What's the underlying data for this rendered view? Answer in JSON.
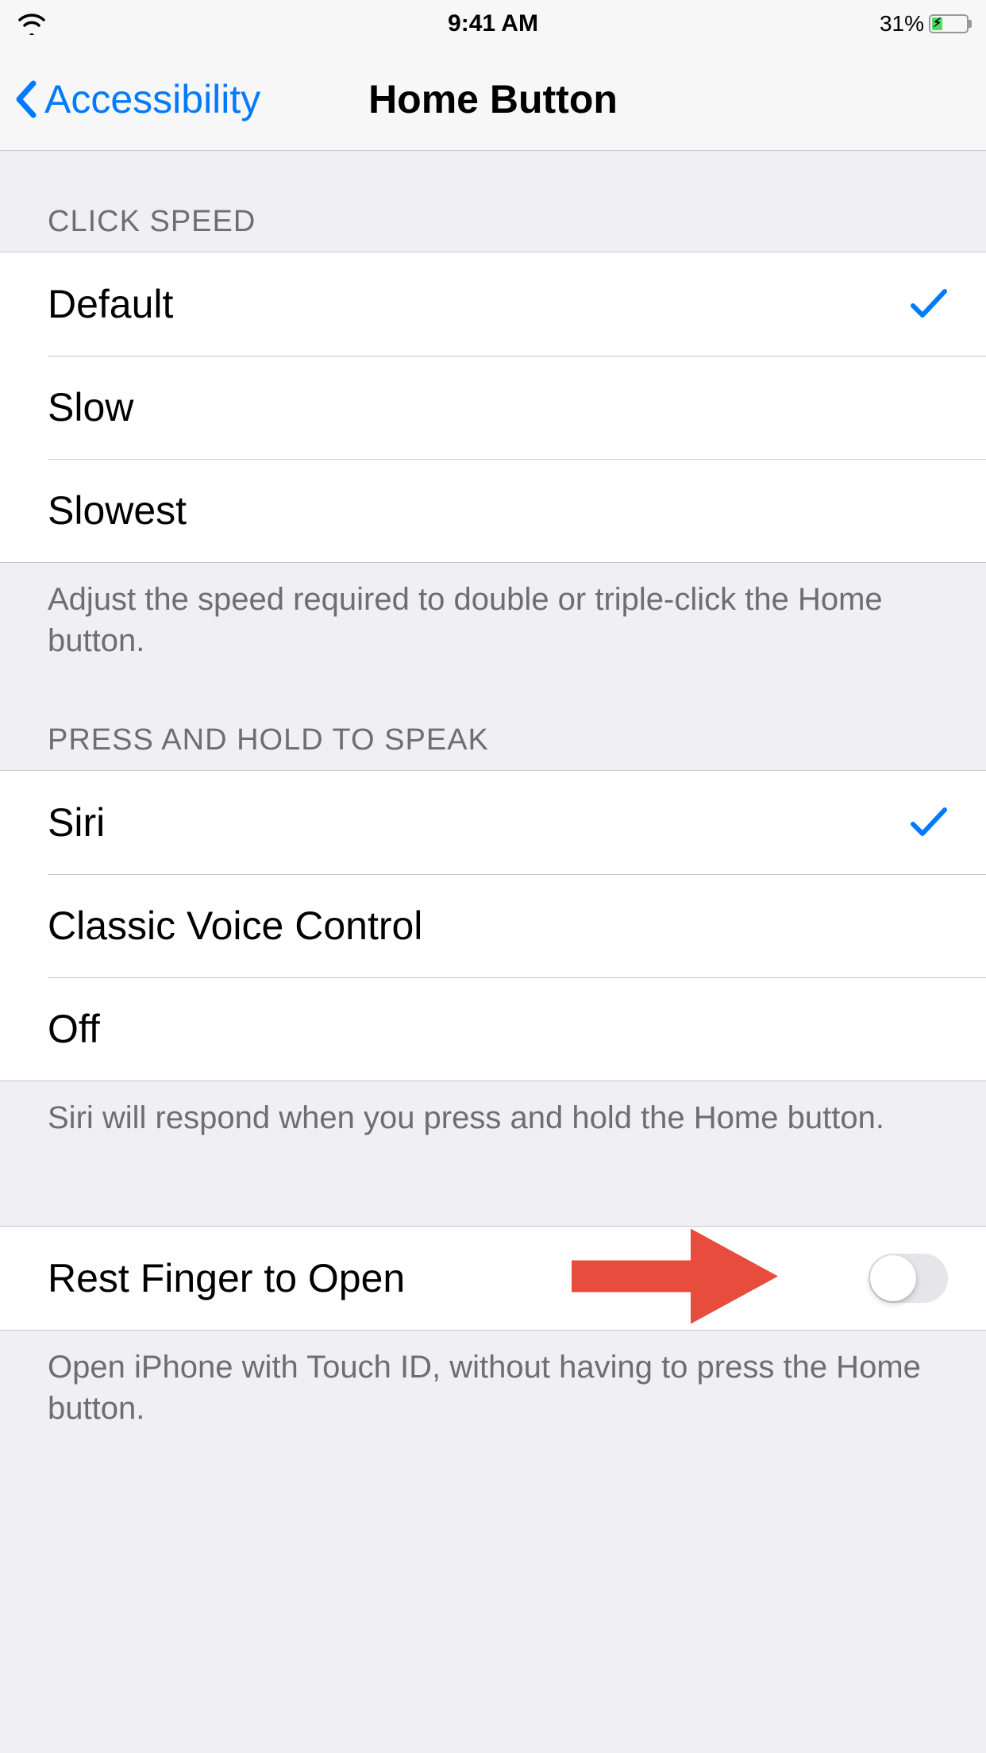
{
  "status": {
    "time": "9:41 AM",
    "battery_pct": "31%",
    "battery_fill_pct": 31
  },
  "nav": {
    "back_label": "Accessibility",
    "title": "Home Button"
  },
  "sections": {
    "click_speed": {
      "header": "CLICK SPEED",
      "options": [
        {
          "label": "Default",
          "selected": true
        },
        {
          "label": "Slow",
          "selected": false
        },
        {
          "label": "Slowest",
          "selected": false
        }
      ],
      "footer": "Adjust the speed required to double or triple-click the Home button."
    },
    "press_hold": {
      "header": "PRESS AND HOLD TO SPEAK",
      "options": [
        {
          "label": "Siri",
          "selected": true
        },
        {
          "label": "Classic Voice Control",
          "selected": false
        },
        {
          "label": "Off",
          "selected": false
        }
      ],
      "footer": "Siri will respond when you press and hold the Home button."
    },
    "rest_finger": {
      "label": "Rest Finger to Open",
      "value": false,
      "footer": "Open iPhone with Touch ID, without having to press the Home button."
    }
  },
  "annotation": {
    "arrow_color": "#e84c3d"
  }
}
